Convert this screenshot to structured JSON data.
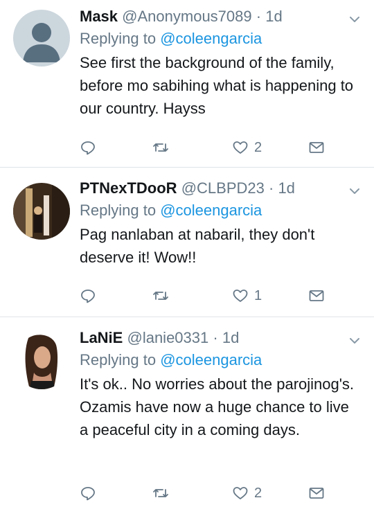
{
  "tweets": [
    {
      "name": "Mask",
      "handle": "@Anonymous7089",
      "sep": "·",
      "time": "1d",
      "replying_prefix": "Replying to",
      "replying_to": "@coleengarcia",
      "text": "See first the background of the family, before mo sabihing what is happening to our country. Hayss",
      "likes": "2",
      "avatar_icon": "default-avatar-icon"
    },
    {
      "name": "PTNexTDooR",
      "handle": "@CLBPD23",
      "sep": "·",
      "time": "1d",
      "replying_prefix": "Replying to",
      "replying_to": "@coleengarcia",
      "text": "Pag nanlaban at nabaril, they don't deserve it! Wow!!",
      "likes": "1",
      "avatar_icon": "photo-avatar"
    },
    {
      "name": "LaNiE",
      "handle": "@lanie0331",
      "sep": "·",
      "time": "1d",
      "replying_prefix": "Replying to",
      "replying_to": "@coleengarcia",
      "text": "It's ok.. No worries about the parojinog's. Ozamis have now a huge chance to live a peaceful city in a coming days.",
      "likes": "2",
      "avatar_icon": "photo-avatar"
    }
  ],
  "colors": {
    "link": "#1b95e0",
    "secondary": "#657786",
    "divider": "#dfe3e7"
  }
}
